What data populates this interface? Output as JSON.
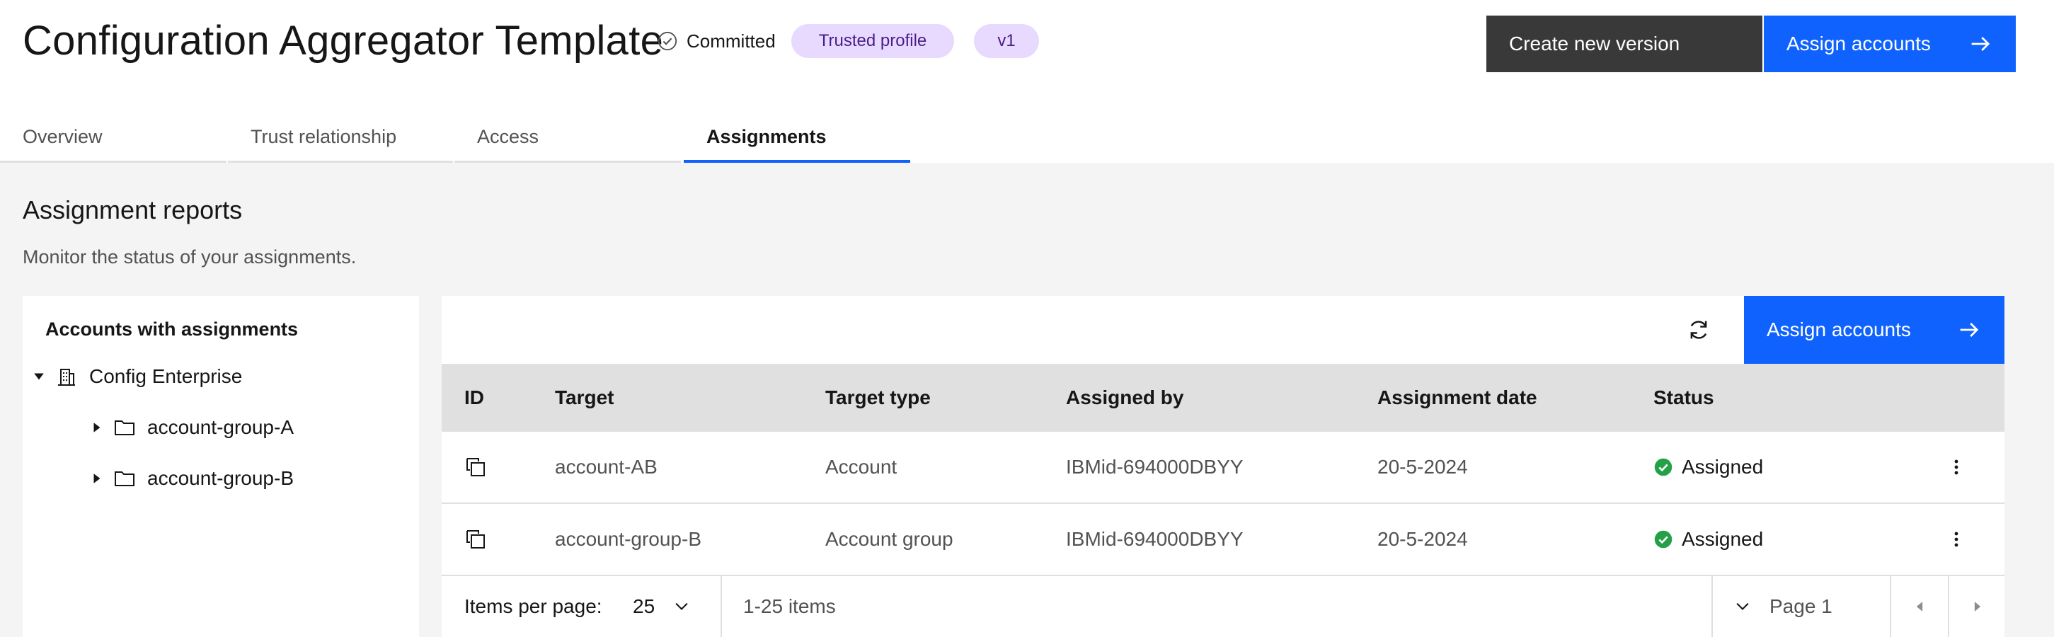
{
  "header": {
    "title": "Configuration Aggregator Template",
    "status": "Committed",
    "tags": [
      "Trusted profile",
      "v1"
    ],
    "buttons": {
      "create_version": "Create new version",
      "assign_accounts": "Assign accounts"
    }
  },
  "tabs": [
    {
      "label": "Overview"
    },
    {
      "label": "Trust relationship"
    },
    {
      "label": "Access"
    },
    {
      "label": "Assignments",
      "selected": true
    }
  ],
  "section": {
    "title": "Assignment reports",
    "subtitle": "Monitor the status of your assignments."
  },
  "left_panel": {
    "title": "Accounts with assignments",
    "tree": {
      "root": "Config Enterprise",
      "children": [
        "account-group-A",
        "account-group-B"
      ]
    }
  },
  "toolbar": {
    "assign_label": "Assign accounts"
  },
  "table": {
    "columns": [
      "ID",
      "Target",
      "Target type",
      "Assigned by",
      "Assignment date",
      "Status"
    ],
    "rows": [
      {
        "target": "account-AB",
        "type": "Account",
        "assigned_by": "IBMid-694000DBYY",
        "date": "20-5-2024",
        "status": "Assigned"
      },
      {
        "target": "account-group-B",
        "type": "Account group",
        "assigned_by": "IBMid-694000DBYY",
        "date": "20-5-2024",
        "status": "Assigned"
      }
    ]
  },
  "pagination": {
    "items_per_page_label": "Items per page:",
    "items_per_page": "25",
    "range": "1-25 items",
    "page": "Page 1"
  },
  "colors": {
    "primary": "#0f62fe",
    "secondary": "#393939",
    "success": "#24a148",
    "tag_bg": "#e8daff"
  },
  "icons": [
    "check-circle-icon",
    "arrow-right-icon",
    "refresh-icon",
    "copy-icon",
    "overflow-menu-icon",
    "building-icon",
    "folder-icon",
    "caret-down-icon",
    "caret-right-icon",
    "chevron-down-icon",
    "caret-left-icon"
  ]
}
